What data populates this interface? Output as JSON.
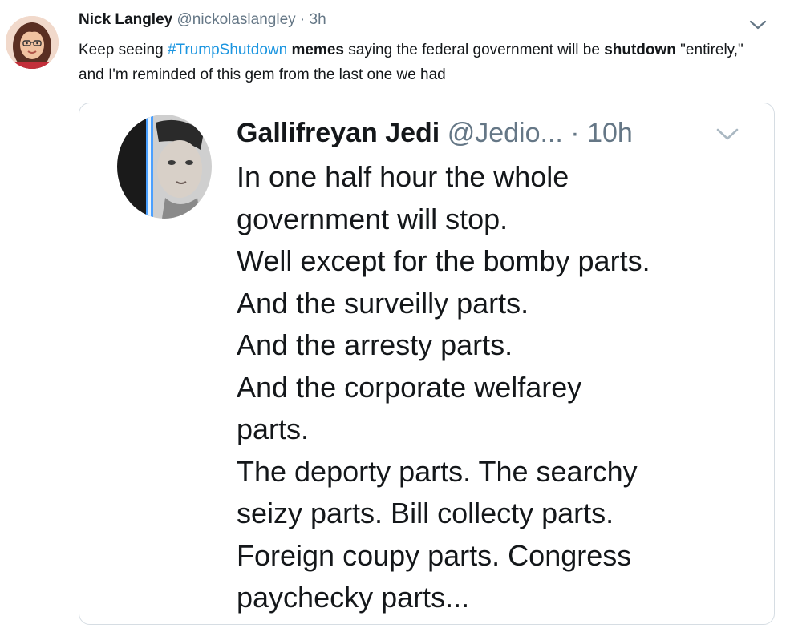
{
  "tweet": {
    "author_name": "Nick Langley",
    "author_handle": "@nickolaslangley",
    "separator": "·",
    "time": "3h",
    "text_parts": {
      "p1": "Keep seeing ",
      "hashtag": "#TrumpShutdown",
      "p2": " ",
      "bold1": "memes",
      "p3": " saying the federal government will be ",
      "bold2": "shutdown",
      "p4": " \"entirely,\" and I'm reminded of this gem from the last one we had"
    },
    "caret_icon": "chevron-down-icon",
    "link_color": "#1b95e0",
    "muted_color": "#657786"
  },
  "quoted": {
    "author_name": "Gallifreyan Jedi",
    "author_handle": "@Jedio...",
    "separator": "·",
    "time": "10h",
    "lines": [
      "In one half hour the whole",
      "government will stop.",
      "Well except for the bomby parts.",
      "And the surveilly parts.",
      "And the arresty parts.",
      "And the corporate welfarey",
      "parts.",
      "The deporty parts.  The searchy",
      "seizy parts. Bill collecty parts.",
      "Foreign coupy parts. Congress",
      "paychecky parts..."
    ],
    "caret_icon": "chevron-down-icon"
  }
}
